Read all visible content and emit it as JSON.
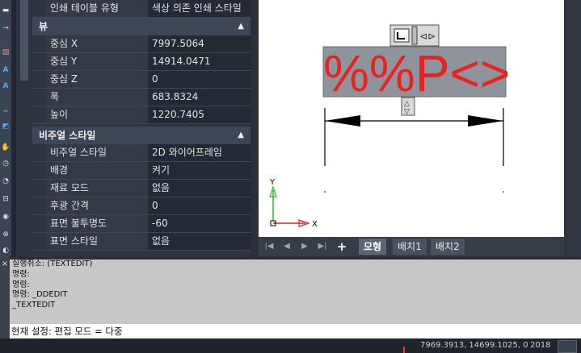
{
  "properties": {
    "top_row": {
      "label": "인쇄 테이블 유형",
      "value": "색상 의존 인쇄 스타일"
    },
    "view": {
      "title": "뷰",
      "rows": [
        {
          "label": "중심 X",
          "value": "7997.5064"
        },
        {
          "label": "중심 Y",
          "value": "14914.0471"
        },
        {
          "label": "중심 Z",
          "value": "0"
        },
        {
          "label": "폭",
          "value": "683.8324"
        },
        {
          "label": "높이",
          "value": "1220.7405"
        }
      ]
    },
    "visual_style": {
      "title": "비주얼 스타일",
      "rows": [
        {
          "label": "비주얼 스타일",
          "value": "2D 와이어프레임"
        },
        {
          "label": "배경",
          "value": "켜기"
        },
        {
          "label": "재료 모드",
          "value": "없음"
        },
        {
          "label": "후광 간격",
          "value": "0"
        },
        {
          "label": "표면 불투명도",
          "value": "-60"
        },
        {
          "label": "표면 스타일",
          "value": "없음"
        }
      ]
    }
  },
  "canvas": {
    "text_content": "%%P<>",
    "text_color": "#e8231f",
    "text_bg_color": "#8f939b",
    "axis_x_label": "X",
    "axis_y_label": "Y"
  },
  "tabs": {
    "nav_icons": [
      "first-icon",
      "prev-icon",
      "next-icon",
      "last-icon"
    ],
    "add": "+",
    "items": [
      "모형",
      "배치1",
      "배치2"
    ],
    "active": "모형"
  },
  "command": {
    "history": [
      "실행취소: (TEXTEDIT)",
      "명령:",
      "명령:",
      "명령: _DDEDIT",
      "_TEXTEDIT"
    ],
    "current": "현재 설정: 편집 모드 = 다중",
    "close_icon": "×"
  },
  "status": {
    "coords": "7969.3913, 14699.1025, 0",
    "year": "2018"
  },
  "colors": {
    "accent_red": "#e23b3b",
    "panel": "#2e3440"
  }
}
